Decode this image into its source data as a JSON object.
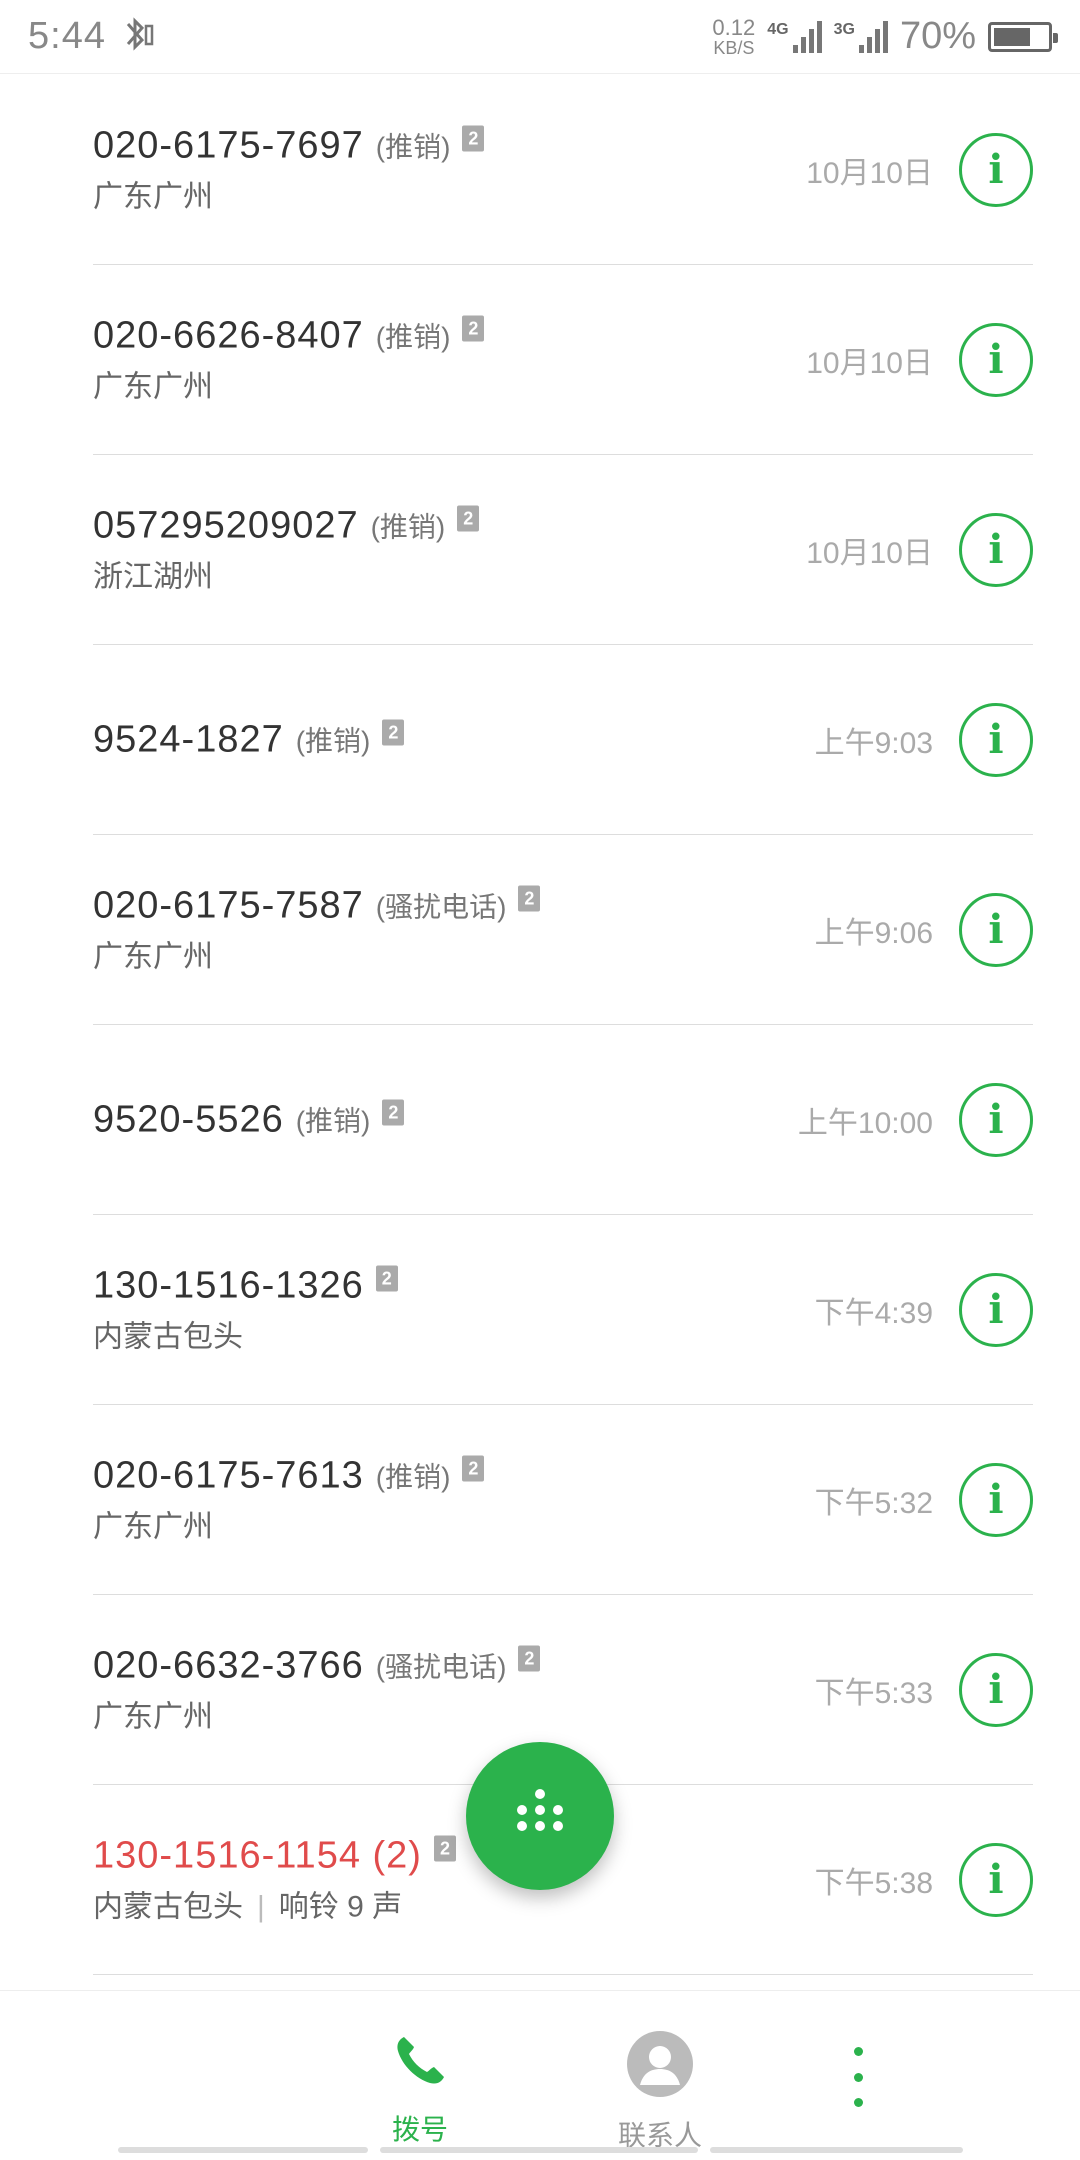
{
  "status_bar": {
    "time": "5:44",
    "net_speed_value": "0.12",
    "net_speed_unit": "KB/S",
    "signal1_label": "4G",
    "signal2_label": "3G",
    "battery_percent": "70%",
    "battery_level": 0.7
  },
  "calls": [
    {
      "number": "020-6175-7697",
      "tag": "(推销)",
      "sim": "2",
      "location": "广东广州",
      "time": "10月10日",
      "missed": false
    },
    {
      "number": "020-6626-8407",
      "tag": "(推销)",
      "sim": "2",
      "location": "广东广州",
      "time": "10月10日",
      "missed": false
    },
    {
      "number": "057295209027",
      "tag": "(推销)",
      "sim": "2",
      "location": "浙江湖州",
      "time": "10月10日",
      "missed": false
    },
    {
      "number": "9524-1827",
      "tag": "(推销)",
      "sim": "2",
      "location": "",
      "time": "上午9:03",
      "missed": false
    },
    {
      "number": "020-6175-7587",
      "tag": "(骚扰电话)",
      "sim": "2",
      "location": "广东广州",
      "time": "上午9:06",
      "missed": false
    },
    {
      "number": "9520-5526",
      "tag": "(推销)",
      "sim": "2",
      "location": "",
      "time": "上午10:00",
      "missed": false
    },
    {
      "number": "130-1516-1326",
      "tag": "",
      "sim": "2",
      "location": "内蒙古包头",
      "time": "下午4:39",
      "missed": false
    },
    {
      "number": "020-6175-7613",
      "tag": "(推销)",
      "sim": "2",
      "location": "广东广州",
      "time": "下午5:32",
      "missed": false
    },
    {
      "number": "020-6632-3766",
      "tag": "(骚扰电话)",
      "sim": "2",
      "location": "广东广州",
      "time": "下午5:33",
      "missed": false
    },
    {
      "number": "130-1516-1154 (2)",
      "tag": "",
      "sim": "2",
      "location": "内蒙古包头",
      "ring_info": "响铃 9 声",
      "time": "下午5:38",
      "missed": true
    }
  ],
  "colors": {
    "accent": "#2bb24c",
    "missed": "#e04b4b"
  },
  "icons": {
    "info": "info-icon",
    "dialpad": "dialpad-icon",
    "phone": "phone-icon",
    "contact": "contact-icon",
    "more": "more-vertical-icon",
    "bluetooth": "bluetooth-icon"
  },
  "info_glyph": "i",
  "nav": {
    "dial_label": "拨号",
    "contacts_label": "联系人"
  }
}
